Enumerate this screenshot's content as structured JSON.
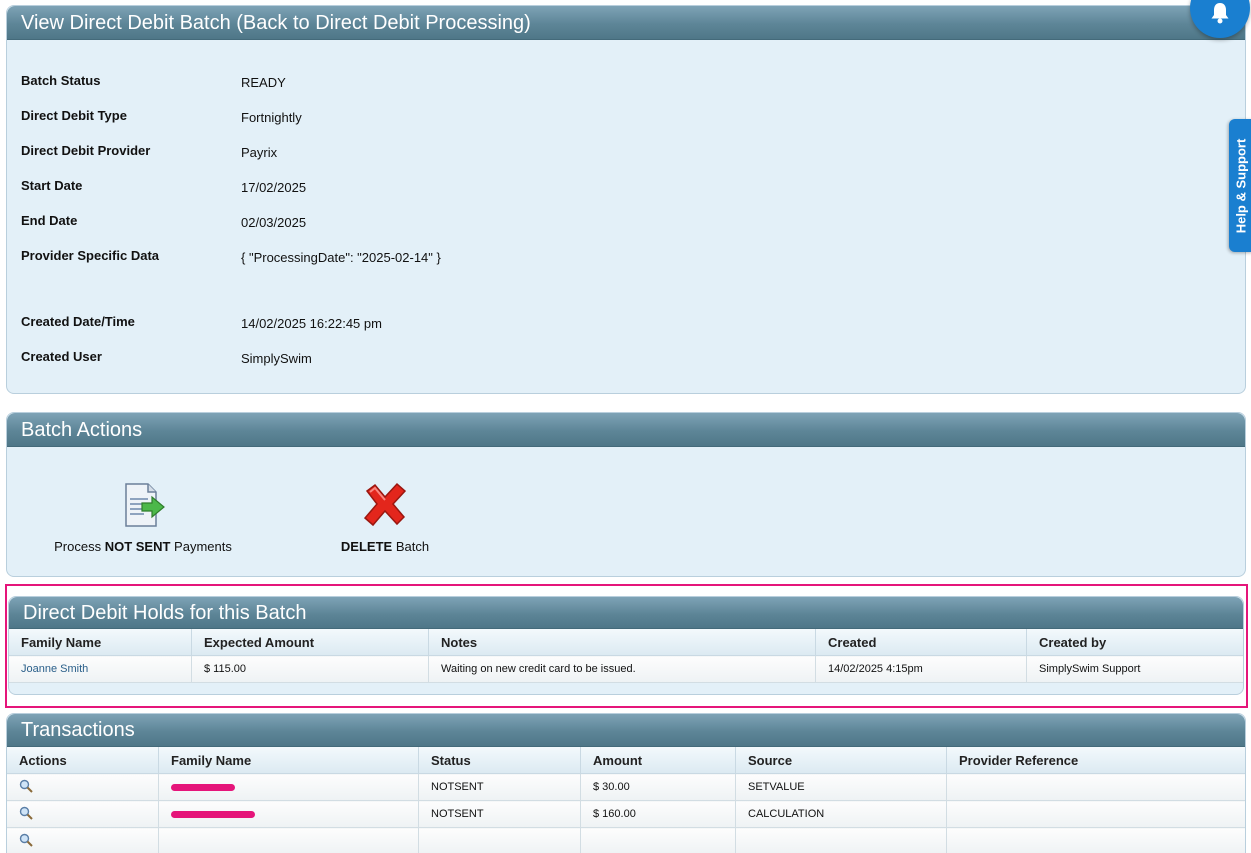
{
  "details": {
    "title": "View Direct Debit Batch (Back to Direct Debit Processing)",
    "fields": [
      {
        "label": "Batch Status",
        "value": "READY"
      },
      {
        "label": "Direct Debit Type",
        "value": "Fortnightly"
      },
      {
        "label": "Direct Debit Provider",
        "value": "Payrix"
      },
      {
        "label": "Start Date",
        "value": "17/02/2025"
      },
      {
        "label": "End Date",
        "value": "02/03/2025"
      },
      {
        "label": "Provider Specific Data",
        "value": "{ \"ProcessingDate\": \"2025-02-14\" }"
      },
      {
        "label": "Created Date/Time",
        "value": "14/02/2025 16:22:45 pm"
      },
      {
        "label": "Created User",
        "value": "SimplySwim"
      }
    ]
  },
  "actions": {
    "title": "Batch Actions",
    "process": {
      "pre": "Process ",
      "bold": "NOT SENT",
      "post": " Payments"
    },
    "delete": {
      "bold": "DELETE",
      "post": " Batch"
    }
  },
  "holds": {
    "title": "Direct Debit Holds for this Batch",
    "columns": [
      "Family Name",
      "Expected Amount",
      "Notes",
      "Created",
      "Created by"
    ],
    "rows": [
      {
        "family": "Joanne Smith",
        "amount": "$ 115.00",
        "notes": "Waiting on new credit card to be issued.",
        "created": "14/02/2025 4:15pm",
        "created_by": "SimplySwim Support"
      }
    ]
  },
  "transactions": {
    "title": "Transactions",
    "columns": [
      "Actions",
      "Family Name",
      "Status",
      "Amount",
      "Source",
      "Provider Reference"
    ],
    "rows": [
      {
        "status": "NOTSENT",
        "amount": "$ 30.00",
        "source": "SETVALUE",
        "reference": ""
      },
      {
        "status": "NOTSENT",
        "amount": "$ 160.00",
        "source": "CALCULATION",
        "reference": ""
      }
    ]
  },
  "help_tab": {
    "label": "Help & Support"
  },
  "icons": {
    "bell": "bell-icon",
    "process": "document-arrow-icon",
    "delete": "red-x-icon",
    "view": "magnifier-icon"
  },
  "colors": {
    "header": "#5d8597",
    "panel_bg": "#e3f0f8",
    "highlight": "#e5157a",
    "accent_blue": "#1a7fd0"
  }
}
